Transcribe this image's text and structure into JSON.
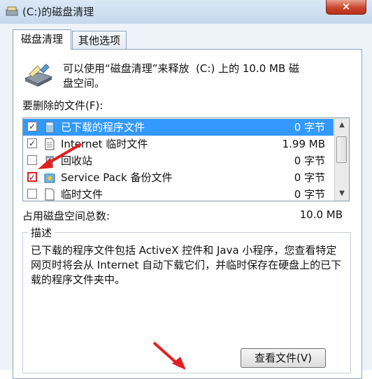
{
  "window": {
    "title": "(C:)的磁盘清理",
    "close_symbol": "×"
  },
  "tabs": [
    {
      "label": "磁盘清理",
      "active": true
    },
    {
      "label": "其他选项",
      "active": false
    }
  ],
  "intro_text": "可以使用“磁盘清理”来释放  (C:) 上的 10.0 MB 磁\n盘空间。",
  "files_label": "要删除的文件(F):",
  "files": [
    {
      "name": "已下载的程序文件",
      "size": "0 字节",
      "checked": true,
      "selected": true,
      "icon": "folder-icon"
    },
    {
      "name": "Internet 临时文件",
      "size": "1.99 MB",
      "checked": true,
      "selected": false,
      "icon": "document-icon"
    },
    {
      "name": "回收站",
      "size": "0 字节",
      "checked": false,
      "selected": false,
      "icon": "recycle-bin-icon"
    },
    {
      "name": "Service Pack 备份文件",
      "size": "0 字节",
      "checked": true,
      "selected": false,
      "icon": "service-pack-icon"
    },
    {
      "name": "临时文件",
      "size": "0 字节",
      "checked": false,
      "selected": false,
      "icon": "file-icon"
    }
  ],
  "check_mark": "✓",
  "scrollbar": {
    "up": "▲",
    "down": "▼"
  },
  "total_label": "占用磁盘空间总数:",
  "total_value": "10.0 MB",
  "description": {
    "legend": "描述",
    "text": "已下载的程序文件包括 ActiveX 控件和 Java 小程序，您查看特定网页时将会从 Internet 自动下载它们，并临时保存在硬盘上的已下载的程序文件夹中。"
  },
  "view_files_button": "查看文件(V)",
  "colors": {
    "selection": "#3399ff",
    "annotation_arrow": "#e02020"
  }
}
